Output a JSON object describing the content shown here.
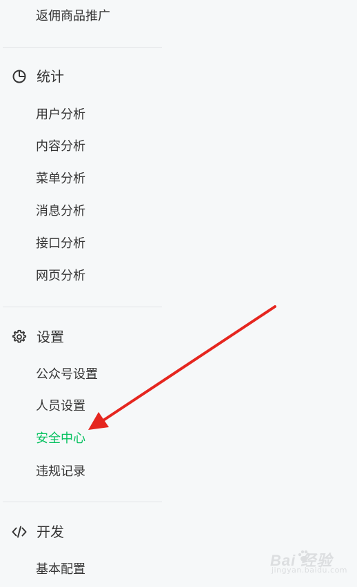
{
  "menu": {
    "top_item": "返佣商品推广",
    "statistics": {
      "title": "统计",
      "items": [
        "用户分析",
        "内容分析",
        "菜单分析",
        "消息分析",
        "接口分析",
        "网页分析"
      ]
    },
    "settings": {
      "title": "设置",
      "items": [
        "公众号设置",
        "人员设置",
        "安全中心",
        "违规记录"
      ]
    },
    "develop": {
      "title": "开发",
      "items": [
        "基本配置"
      ]
    }
  },
  "watermark": {
    "brand": "Bai  经验",
    "sub": "jingyan.baidu.com"
  },
  "colors": {
    "text": "#353535",
    "active": "#07c160",
    "annotation_arrow": "#e5261f"
  },
  "icons": {
    "statistics": "pie-chart-icon",
    "settings": "gear-icon",
    "develop": "code-icon"
  }
}
